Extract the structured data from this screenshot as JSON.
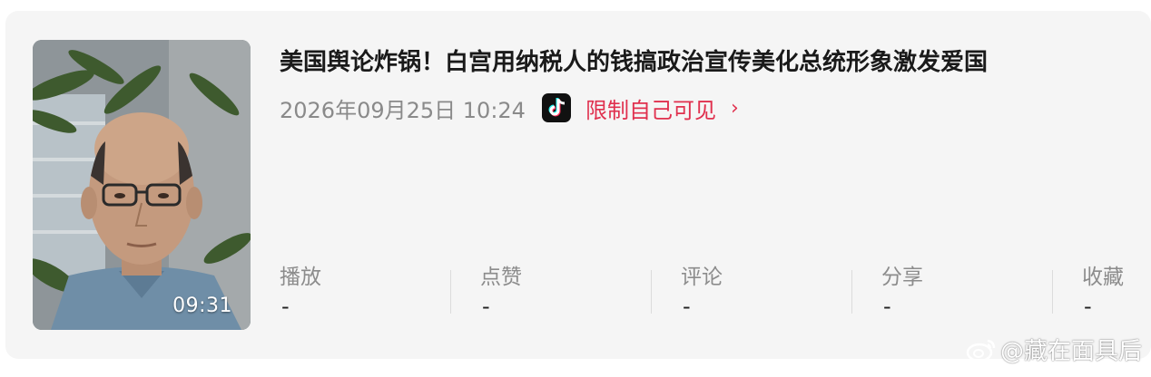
{
  "video": {
    "duration": "09:31",
    "title": "美国舆论炸锅！白宫用纳税人的钱搞政治宣传美化总统形象激发爱国",
    "date": "2026年09月25日 10:24",
    "platform_icon": "tiktok-icon",
    "visibility": "限制自己可见",
    "chevron": "›"
  },
  "stats": [
    {
      "label": "播放",
      "value": "-"
    },
    {
      "label": "点赞",
      "value": "-"
    },
    {
      "label": "评论",
      "value": "-"
    },
    {
      "label": "分享",
      "value": "-"
    },
    {
      "label": "收藏",
      "value": "-"
    }
  ],
  "watermark": {
    "text": "@藏在面具后"
  },
  "colors": {
    "accent": "#e0304e",
    "card_bg": "#f5f5f5",
    "muted_text": "#8a8a8a"
  }
}
